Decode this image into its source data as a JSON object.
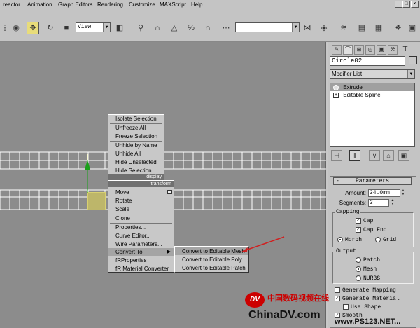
{
  "menubar": {
    "items": [
      "reactor",
      "Animation",
      "Graph Editors",
      "Rendering",
      "Customize",
      "MAXScript",
      "Help"
    ],
    "window_buttons": [
      "_",
      "□",
      "×"
    ]
  },
  "toolbar": {
    "view_select": "View",
    "selection_set": ""
  },
  "viewport": {
    "quad_upper": {
      "items": [
        "Isolate Selection",
        "Unfreeze All",
        "Freeze Selection",
        "Unhide by Name",
        "Unhide All",
        "Hide Unselected",
        "Hide Selection"
      ],
      "header": "display"
    },
    "quad_lower": {
      "header": "transform",
      "items": [
        "Move",
        "Rotate",
        "Scale",
        "Clone",
        "Properties...",
        "Curve Editor...",
        "Wire Parameters...",
        "Convert To:",
        "fRProperties",
        "fR Material Converter"
      ],
      "submenu_arrow": "▶"
    },
    "submenu": {
      "items": [
        "Convert to Editable Mesh",
        "Convert to Editable Poly",
        "Convert to Editable Patch"
      ]
    }
  },
  "command_panel": {
    "object_name": "Circle02",
    "modifier_list": "Modifier List",
    "stack": [
      {
        "label": "Extrude",
        "selected": true,
        "symbol": "💡"
      },
      {
        "label": "Editable Spline",
        "selected": false,
        "symbol": "+"
      }
    ],
    "parameters": {
      "title": "Parameters",
      "collapse_symbol": "-",
      "amount_label": "Amount:",
      "amount_value": "34.0mm",
      "segments_label": "Segments:",
      "segments_value": "3",
      "capping_label": "Capping",
      "cap_start": "Cap",
      "cap_end": "Cap End",
      "morph": "Morph",
      "grid": "Grid",
      "output_label": "Output",
      "patch": "Patch",
      "mesh": "Mesh",
      "nurbs": "NURBS",
      "generate_mapping": "Generate Mapping",
      "generate_material": "Generate Material",
      "use_shape": "Use Shape",
      "smooth": "Smooth"
    }
  },
  "watermark": {
    "logo": "DV",
    "chinese": "中国数码视频在线",
    "site": "ChinaDV.com",
    "site2": "www.PS123.NET..."
  },
  "colors": {
    "viewport_bg": "#8c8c8c",
    "highlight": "#a4a4a4",
    "ui_face": "#c4c4c4",
    "watermark_red": "#cc0000"
  }
}
